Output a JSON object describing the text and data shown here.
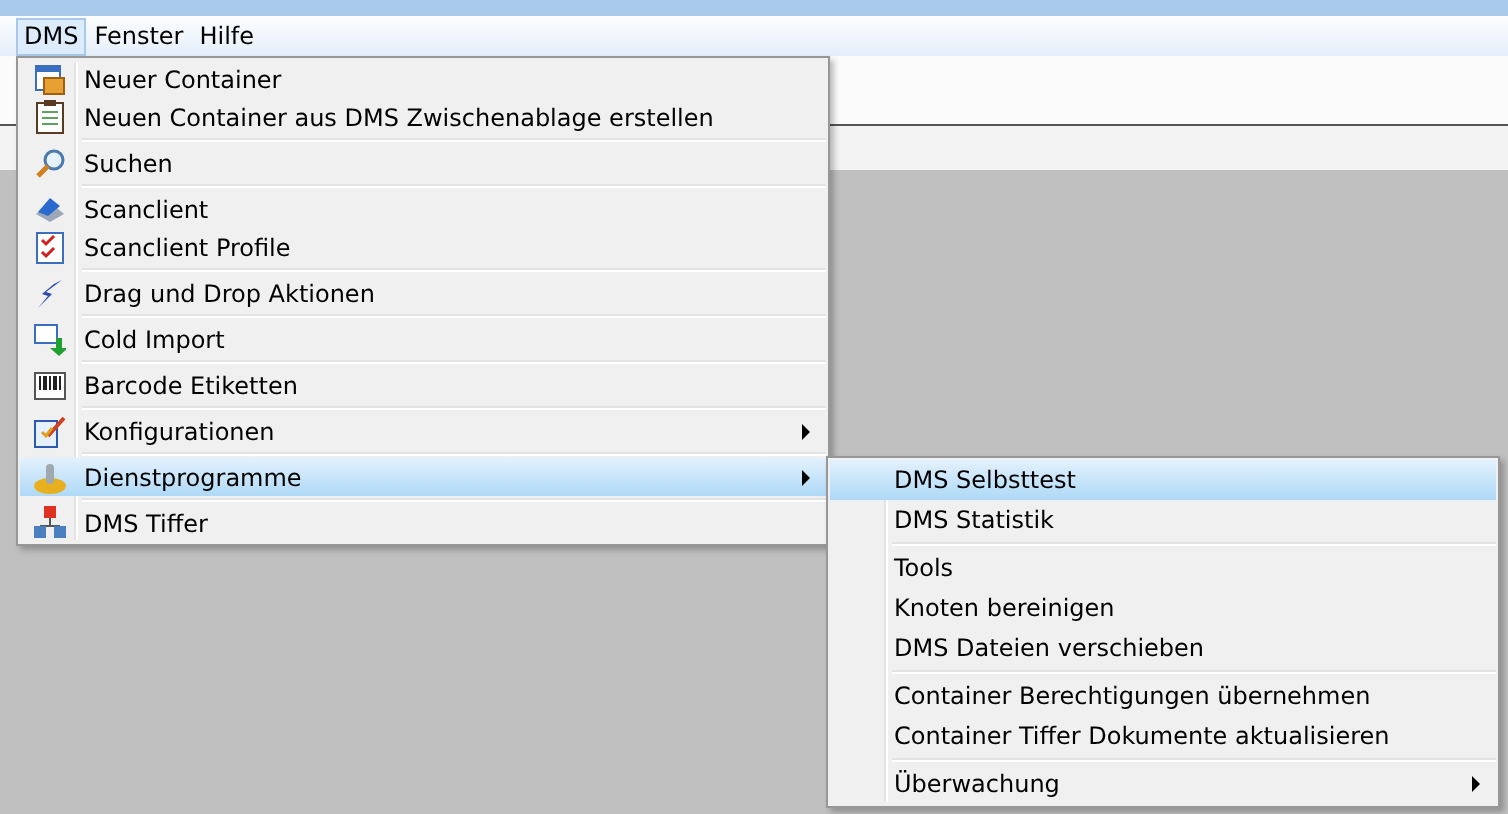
{
  "menubar": [
    {
      "label": "DMS",
      "selected": true
    },
    {
      "label": "Fenster",
      "selected": false
    },
    {
      "label": "Hilfe",
      "selected": false
    }
  ],
  "menu": {
    "groups": [
      [
        {
          "label": "Neuer Container",
          "submenu": false,
          "selected": false
        },
        {
          "label": "Neuen Container aus DMS Zwischenablage erstellen",
          "submenu": false,
          "selected": false
        }
      ],
      [
        {
          "label": "Suchen",
          "submenu": false,
          "selected": false
        }
      ],
      [
        {
          "label": "Scanclient",
          "submenu": false,
          "selected": false
        },
        {
          "label": "Scanclient Profile",
          "submenu": false,
          "selected": false
        }
      ],
      [
        {
          "label": "Drag und Drop Aktionen",
          "submenu": false,
          "selected": false
        }
      ],
      [
        {
          "label": "Cold Import",
          "submenu": false,
          "selected": false
        }
      ],
      [
        {
          "label": "Barcode Etiketten",
          "submenu": false,
          "selected": false
        }
      ],
      [
        {
          "label": "Konfigurationen",
          "submenu": true,
          "selected": false
        }
      ],
      [
        {
          "label": "Dienstprogramme",
          "submenu": true,
          "selected": true
        }
      ],
      [
        {
          "label": "DMS Tiffer",
          "submenu": false,
          "selected": false
        }
      ]
    ]
  },
  "submenu": {
    "groups": [
      [
        {
          "label": "DMS Selbsttest",
          "submenu": false,
          "selected": true
        },
        {
          "label": "DMS Statistik",
          "submenu": false,
          "selected": false
        }
      ],
      [
        {
          "label": "Tools",
          "submenu": false,
          "selected": false
        },
        {
          "label": "Knoten bereinigen",
          "submenu": false,
          "selected": false
        },
        {
          "label": "DMS Dateien verschieben",
          "submenu": false,
          "selected": false
        }
      ],
      [
        {
          "label": "Container Berechtigungen übernehmen",
          "submenu": false,
          "selected": false
        },
        {
          "label": "Container Tiffer Dokumente aktualisieren",
          "submenu": false,
          "selected": false
        }
      ],
      [
        {
          "label": "Überwachung",
          "submenu": true,
          "selected": false
        }
      ]
    ]
  }
}
